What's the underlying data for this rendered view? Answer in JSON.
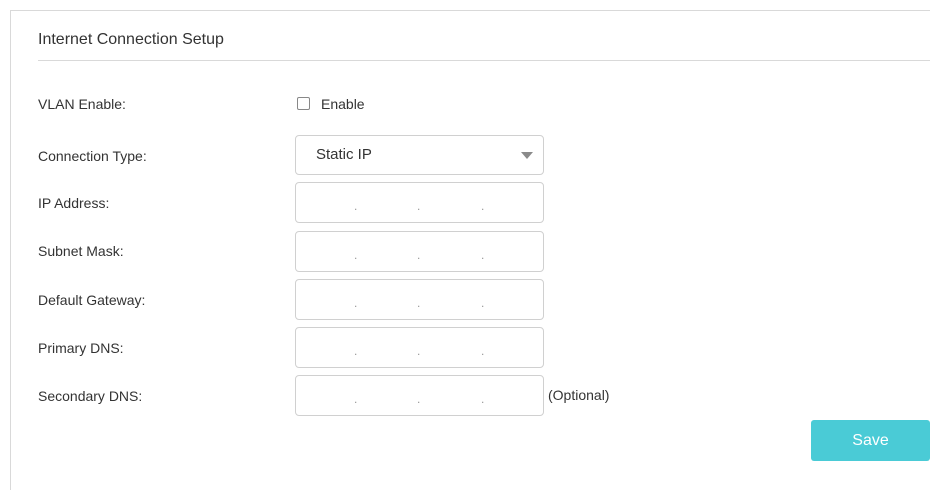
{
  "section": {
    "title": "Internet Connection Setup"
  },
  "vlan": {
    "label": "VLAN Enable:",
    "checkbox_label": "Enable",
    "checked": false
  },
  "connection_type": {
    "label": "Connection Type:",
    "selected": "Static IP"
  },
  "fields": {
    "ip_address": {
      "label": "IP Address:",
      "dots": ".",
      "value": ""
    },
    "subnet_mask": {
      "label": "Subnet Mask:",
      "dots": ".",
      "value": ""
    },
    "default_gateway": {
      "label": "Default Gateway:",
      "dots": ".",
      "value": ""
    },
    "primary_dns": {
      "label": "Primary DNS:",
      "dots": ".",
      "value": ""
    },
    "secondary_dns": {
      "label": "Secondary DNS:",
      "dots": ".",
      "value": "",
      "note": "(Optional)"
    }
  },
  "actions": {
    "save_label": "Save"
  },
  "colors": {
    "accent": "#4acbd6",
    "border": "#d0d0d0",
    "text": "#333333"
  }
}
